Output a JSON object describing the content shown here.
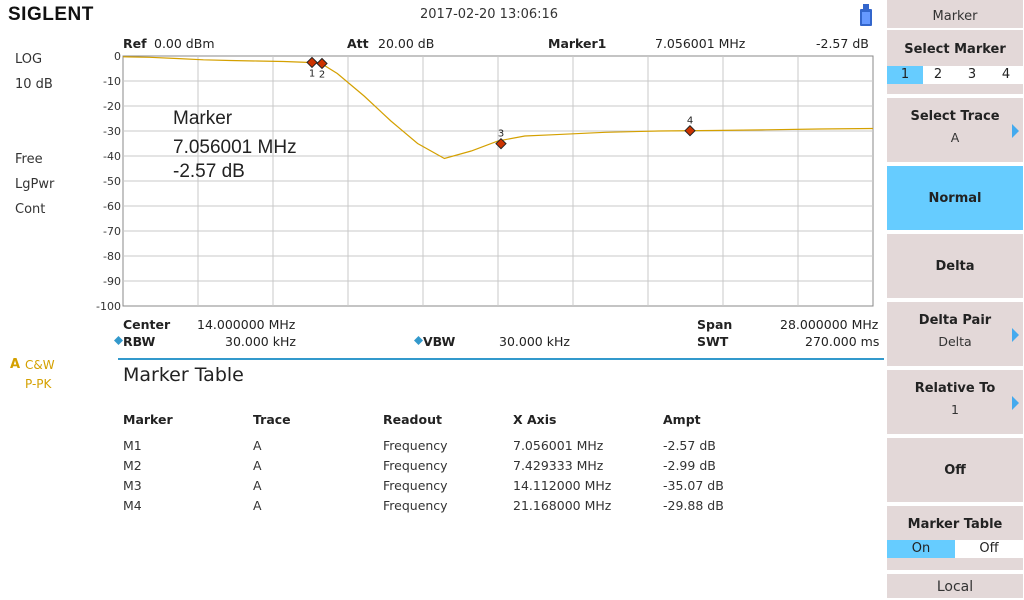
{
  "header": {
    "brand": "SIGLENT",
    "datetime": "2017-02-20   13:06:16"
  },
  "left_panel": {
    "scale_type": "LOG",
    "scale_div": "10 dB",
    "trig": "Free",
    "detector": "LgPwr",
    "sweep": "Cont",
    "trace_letter": "A",
    "trace_mode": "C&W",
    "trace_detect": "P-PK"
  },
  "top_info": {
    "ref_label": "Ref",
    "ref_value": "0.00 dBm",
    "att_label": "Att",
    "att_value": "20.00 dB",
    "marker_label": "Marker1",
    "marker_freq": "7.056001 MHz",
    "marker_ampl": "-2.57 dB"
  },
  "marker_readout": {
    "title": "Marker",
    "freq": "7.056001 MHz",
    "ampl": "-2.57 dB"
  },
  "bottom_info": {
    "center_label": "Center",
    "center_value": "14.000000 MHz",
    "span_label": "Span",
    "span_value": "28.000000 MHz",
    "rbw_label": "RBW",
    "rbw_value": "30.000 kHz",
    "vbw_label": "VBW",
    "vbw_value": "30.000 kHz",
    "swt_label": "SWT",
    "swt_value": "270.000 ms"
  },
  "chart_data": {
    "type": "line",
    "y_ticks": [
      "0",
      "-10",
      "-20",
      "-30",
      "-40",
      "-50",
      "-60",
      "-70",
      "-80",
      "-90",
      "-100"
    ],
    "ylim": [
      -100,
      0
    ],
    "xlim": [
      0,
      28
    ],
    "x_units": "MHz",
    "grid": true,
    "series": [
      {
        "color": "#d4a000",
        "x": [
          0,
          1,
          2,
          3,
          4,
          5,
          6,
          7,
          7.4,
          8,
          9,
          10,
          11,
          12,
          13,
          14,
          15,
          16,
          18,
          20,
          22,
          24,
          26,
          28
        ],
        "values": [
          -0.3,
          -0.5,
          -1.0,
          -1.5,
          -1.8,
          -2.0,
          -2.2,
          -2.6,
          -3.0,
          -7,
          -16,
          -26,
          -35,
          -41,
          -38,
          -34,
          -32,
          -31.5,
          -30.5,
          -30,
          -29.8,
          -29.5,
          -29.2,
          -29
        ]
      }
    ],
    "markers": [
      {
        "label": "1",
        "x": 7.056001,
        "y": -2.57
      },
      {
        "label": "2",
        "x": 7.429333,
        "y": -2.99
      },
      {
        "label": "3",
        "x": 14.112,
        "y": -35.07
      },
      {
        "label": "4",
        "x": 21.168,
        "y": -29.88
      }
    ]
  },
  "marker_table": {
    "title": "Marker Table",
    "headers": [
      "Marker",
      "Trace",
      "Readout",
      "X Axis",
      "Ampt"
    ],
    "rows": [
      [
        "M1",
        "A",
        "Frequency",
        "7.056001 MHz",
        "-2.57 dB"
      ],
      [
        "M2",
        "A",
        "Frequency",
        "7.429333 MHz",
        "-2.99 dB"
      ],
      [
        "M3",
        "A",
        "Frequency",
        "14.112000 MHz",
        "-35.07 dB"
      ],
      [
        "M4",
        "A",
        "Frequency",
        "21.168000 MHz",
        "-29.88 dB"
      ]
    ]
  },
  "softkeys": {
    "menu_title": "Marker",
    "select_marker": {
      "title": "Select Marker",
      "options": [
        "1",
        "2",
        "3",
        "4"
      ],
      "selected": "1"
    },
    "select_trace": {
      "title": "Select Trace",
      "value": "A"
    },
    "normal": {
      "title": "Normal"
    },
    "delta": {
      "title": "Delta"
    },
    "delta_pair": {
      "title": "Delta Pair",
      "value": "Delta"
    },
    "relative_to": {
      "title": "Relative To",
      "value": "1"
    },
    "off": {
      "title": "Off"
    },
    "marker_table": {
      "title": "Marker Table",
      "on": "On",
      "off": "Off",
      "selected": "On"
    },
    "local": "Local"
  },
  "colors": {
    "accent": "#66ccff",
    "softkey_bg": "#e3d8d8",
    "trace": "#d4a000",
    "marker": "#cc3300"
  }
}
